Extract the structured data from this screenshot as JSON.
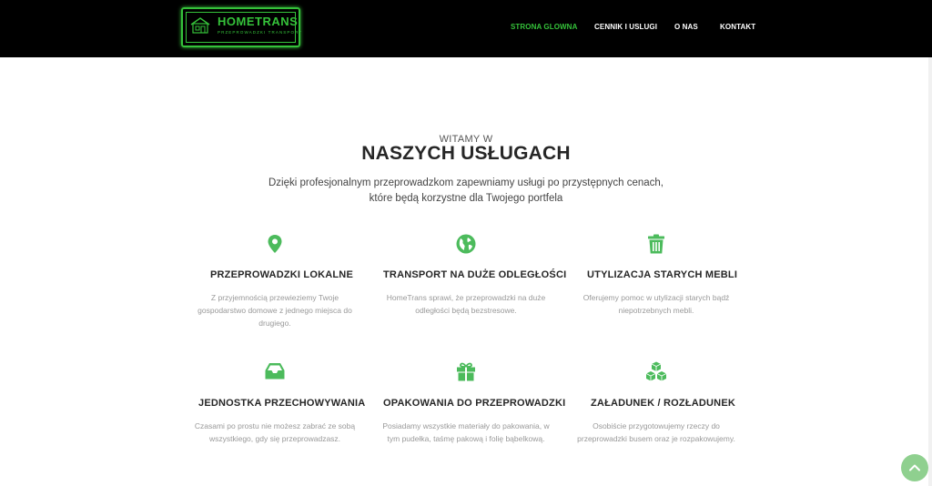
{
  "header": {
    "logo": {
      "name": "HOMETRANS",
      "tagline": "PRZEPROWADZKI TRANSPORT"
    },
    "nav": [
      {
        "label": "STRONA GLOWNA",
        "active": true
      },
      {
        "label": "CENNIK I USLUGI",
        "active": false
      },
      {
        "label": "O NAS",
        "active": false
      },
      {
        "label": "KONTAKT",
        "active": false
      }
    ]
  },
  "intro": {
    "welcome": "WITAMY W",
    "title": "NASZYCH USŁUGACH",
    "text_line1": "Dzięki profesjonalnym przeprowadzkom zapewniamy usługi po przystępnych cenach,",
    "text_line2": "które będą korzystne dla Twojego portfela"
  },
  "services": [
    {
      "icon": "map-pin-icon",
      "title": "PRZEPROWADZKI LOKALNE",
      "desc_lines": [
        "Z przyjemnością przewieziemy Twoje",
        "gospodarstwo domowe z jednego miejsca do",
        "drugiego."
      ]
    },
    {
      "icon": "globe-icon",
      "title": "TRANSPORT NA DUŻE ODLEGŁOŚCI",
      "desc_lines": [
        "HomeTrans sprawi, że przeprowadzki na duże",
        "odległości będą bezstresowe."
      ]
    },
    {
      "icon": "trash-icon",
      "title": "UTYLIZACJA STARYCH MEBLI",
      "desc_lines": [
        "Oferujemy pomoc w utylizacji starych bądź",
        "niepotrzebnych mebli."
      ]
    },
    {
      "icon": "inbox-icon",
      "title": "JEDNOSTKA PRZECHOWYWANIA",
      "desc_lines": [
        "Czasami po prostu nie możesz zabrać ze sobą",
        "wszystkiego, gdy się przeprowadzasz."
      ]
    },
    {
      "icon": "gift-icon",
      "title": "OPAKOWANIA DO PRZEPROWADZKI",
      "desc_lines": [
        "Posiadamy wszystkie materiały do pakowania, w",
        "tym pudełka, taśmę pakową i folię bąbelkową."
      ]
    },
    {
      "icon": "boxes-icon",
      "title": "ZAŁADUNEK / ROZŁADUNEK",
      "desc_lines": [
        "Osobiście przygotowujemy rzeczy do",
        "przeprowadzki busem oraz je rozpakowujemy."
      ]
    }
  ],
  "colors": {
    "accent": "#35c23a",
    "icon": "#4cbb5c",
    "header_bg": "#000000",
    "to_top": "#8fd08f"
  }
}
